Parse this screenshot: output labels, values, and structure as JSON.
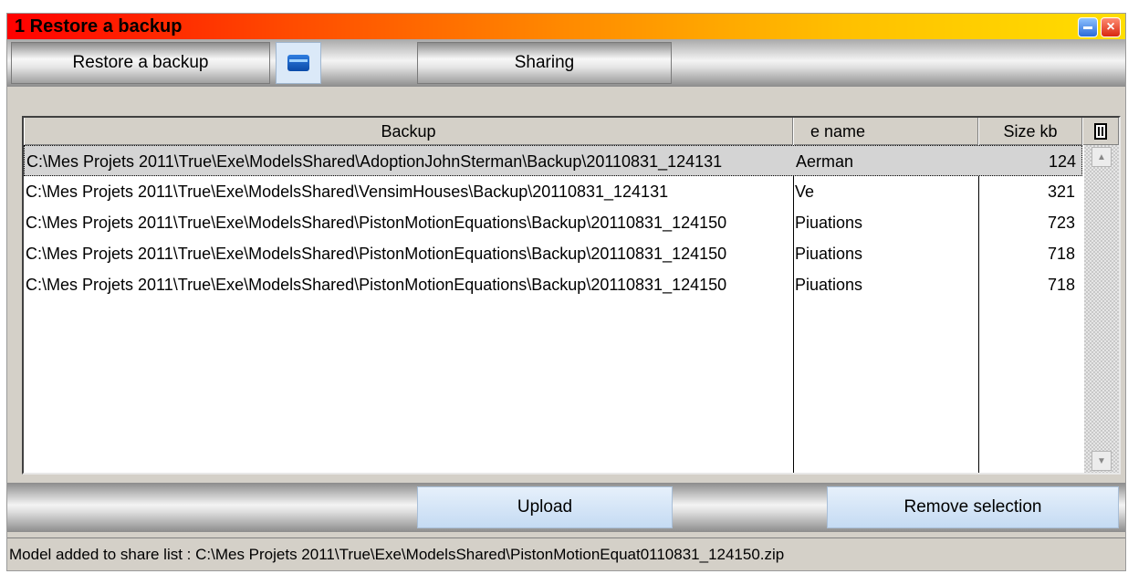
{
  "window": {
    "title": "1 Restore a backup",
    "minimize_glyph": "",
    "close_glyph": "×",
    "accent_gradient": [
      "#ff0000",
      "#ffde00"
    ]
  },
  "toolbar": {
    "tabs": [
      {
        "label": "Restore a backup"
      },
      {
        "label": "Sharing"
      }
    ],
    "folder_icon": "folder-icon"
  },
  "list": {
    "columns": [
      "Backup",
      "e name",
      "Size kb"
    ],
    "delete_icon": "trash-icon",
    "rows": [
      {
        "backup": "C:\\Mes Projets 2011\\True\\Exe\\ModelsShared\\AdoptionJohnSterman\\Backup\\20110831_124131",
        "name": "Aerman",
        "size": "124",
        "selected": true
      },
      {
        "backup": "C:\\Mes Projets 2011\\True\\Exe\\ModelsShared\\VensimHouses\\Backup\\20110831_124131",
        "name": "Ve",
        "size": "321",
        "selected": false
      },
      {
        "backup": "C:\\Mes Projets 2011\\True\\Exe\\ModelsShared\\PistonMotionEquations\\Backup\\20110831_124150",
        "name": "Piuations",
        "size": "723",
        "selected": false
      },
      {
        "backup": "C:\\Mes Projets 2011\\True\\Exe\\ModelsShared\\PistonMotionEquations\\Backup\\20110831_124150",
        "name": "Piuations",
        "size": "718",
        "selected": false
      },
      {
        "backup": "C:\\Mes Projets 2011\\True\\Exe\\ModelsShared\\PistonMotionEquations\\Backup\\20110831_124150",
        "name": "Piuations",
        "size": "718",
        "selected": false
      }
    ]
  },
  "actions": {
    "upload_label": "Upload",
    "remove_label": "Remove selection"
  },
  "status": {
    "text": "Model added to share list : C:\\Mes Projets 2011\\True\\Exe\\ModelsShared\\PistonMotionEquat0110831_124150.zip"
  }
}
